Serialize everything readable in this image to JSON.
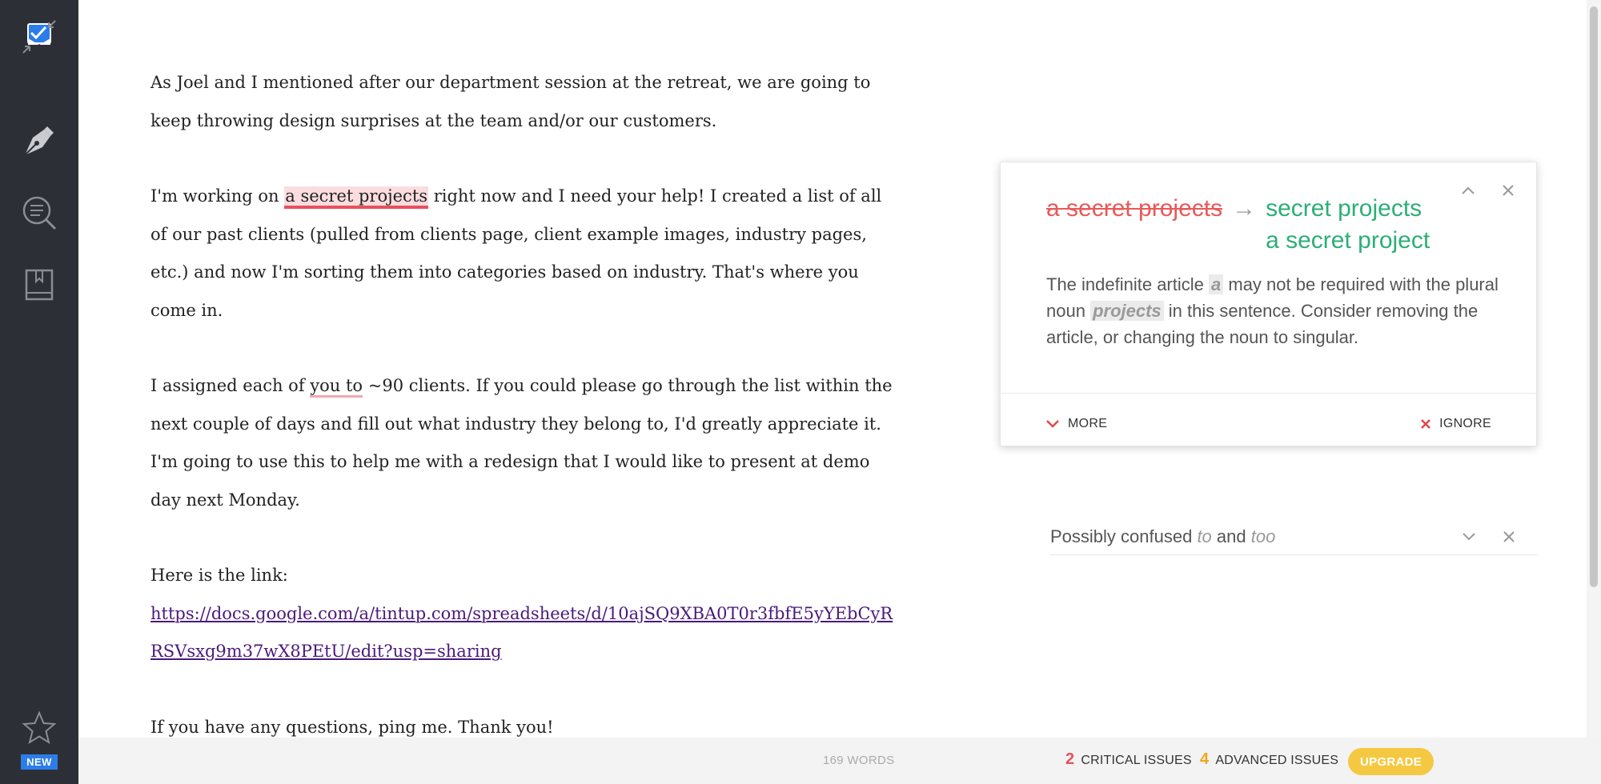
{
  "sidebar": {
    "new_badge": "NEW",
    "icons": [
      "mail-check-icon",
      "pen-nib-icon",
      "plagiarism-search-icon",
      "dictionary-book-icon",
      "star-icon"
    ]
  },
  "document": {
    "p1": "As Joel and I mentioned after our department session at the retreat, we are going to keep throwing design surprises at the team and/or our customers.",
    "p2_before": "I'm working on ",
    "p2_flag": "a secret projects",
    "p2_after": " right now and I need your help! I created a list of all of our past clients (pulled from clients page, client example images, industry pages, etc.) and now I'm sorting them into categories based on industry. That's where you come in.",
    "p3_before": "I assigned each of ",
    "p3_flag": "you to",
    "p3_after": " ~90 clients. If you could please go through the list  within the next couple of days and fill out what industry they belong to, I'd greatly appreciate it. I'm going to use this to help me with a redesign that I would like to present at demo day next Monday.",
    "p4_label": "Here is the link:",
    "p4_link": "https://docs.google.com/a/tintup.com/spreadsheets/d/10ajSQ9XBA0T0r3fbfE5yYEbCyRRSVsxg9m37wX8PEtU/edit?usp=sharing",
    "p5": "If you have any questions, ping me. Thank you!"
  },
  "card": {
    "original": "a secret projects",
    "arrow": "→",
    "suggestions": [
      "secret projects",
      "a secret project"
    ],
    "explain_1": "The indefinite article ",
    "explain_hl1": "a",
    "explain_2": " may not be required with the plural noun ",
    "explain_hl2": "projects",
    "explain_3": " in this sentence. Consider removing the article, or changing the noun to singular.",
    "more_label": "MORE",
    "ignore_label": "IGNORE"
  },
  "alert": {
    "prefix": "Possibly confused ",
    "word1": "to",
    "mid": " and ",
    "word2": "too"
  },
  "status": {
    "words": "169 WORDS",
    "critical_count": "2",
    "critical_label": "CRITICAL ISSUES",
    "advanced_count": "4",
    "advanced_label": "ADVANCED ISSUES",
    "upgrade_label": "UPGRADE"
  },
  "colors": {
    "sidebar": "#2d2f36",
    "critical": "#e8505b",
    "advanced": "#f2a520",
    "correction": "#2dae76",
    "upgrade": "#f5c842",
    "link": "#4b1a7a"
  }
}
